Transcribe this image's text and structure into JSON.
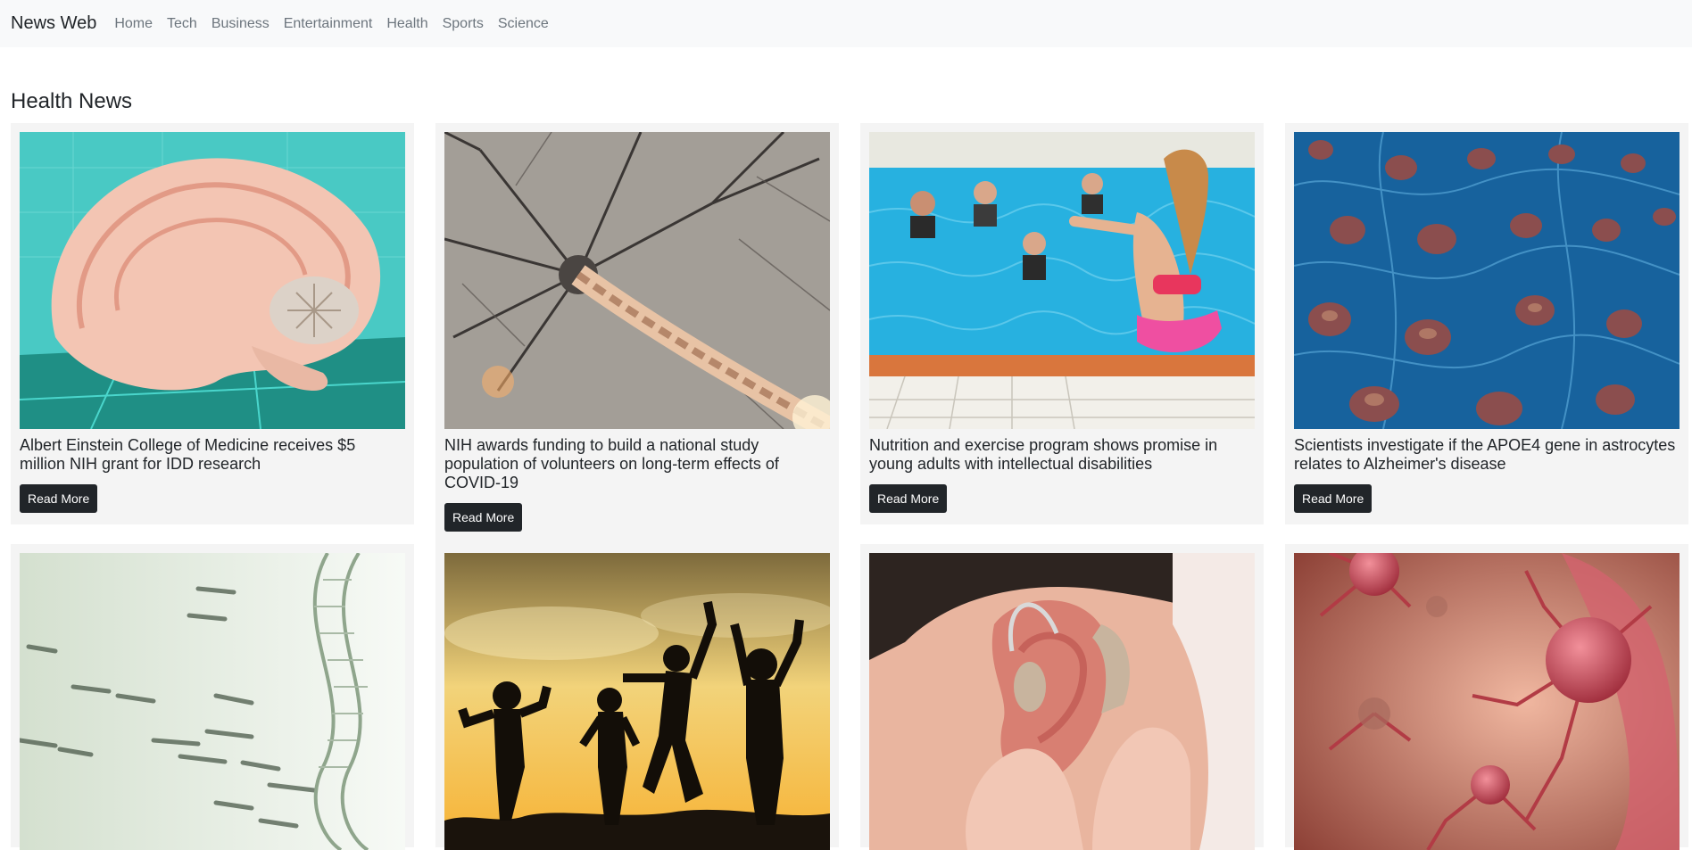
{
  "navbar": {
    "brand": "News Web",
    "links": [
      "Home",
      "Tech",
      "Business",
      "Entertainment",
      "Health",
      "Sports",
      "Science"
    ]
  },
  "page": {
    "title": "Health News"
  },
  "cards": [
    {
      "title": "Albert Einstein College of Medicine receives $5 million NIH grant for IDD research",
      "button": "Read More",
      "image": "brain-model"
    },
    {
      "title": "NIH awards funding to build a national study population of volunteers on long-term effects of COVID-19",
      "button": "Read More",
      "image": "neuron"
    },
    {
      "title": "Nutrition and exercise program shows promise in young adults with intellectual disabilities",
      "button": "Read More",
      "image": "pool-exercise"
    },
    {
      "title": "Scientists investigate if the APOE4 gene in astrocytes relates to Alzheimer's disease",
      "button": "Read More",
      "image": "cells"
    },
    {
      "title": "",
      "button": "",
      "image": "dna-gel"
    },
    {
      "title": "",
      "button": "",
      "image": "children-silhouettes-sunset"
    },
    {
      "title": "",
      "button": "",
      "image": "hearing-aid"
    },
    {
      "title": "",
      "button": "",
      "image": "cancer-cells"
    }
  ]
}
